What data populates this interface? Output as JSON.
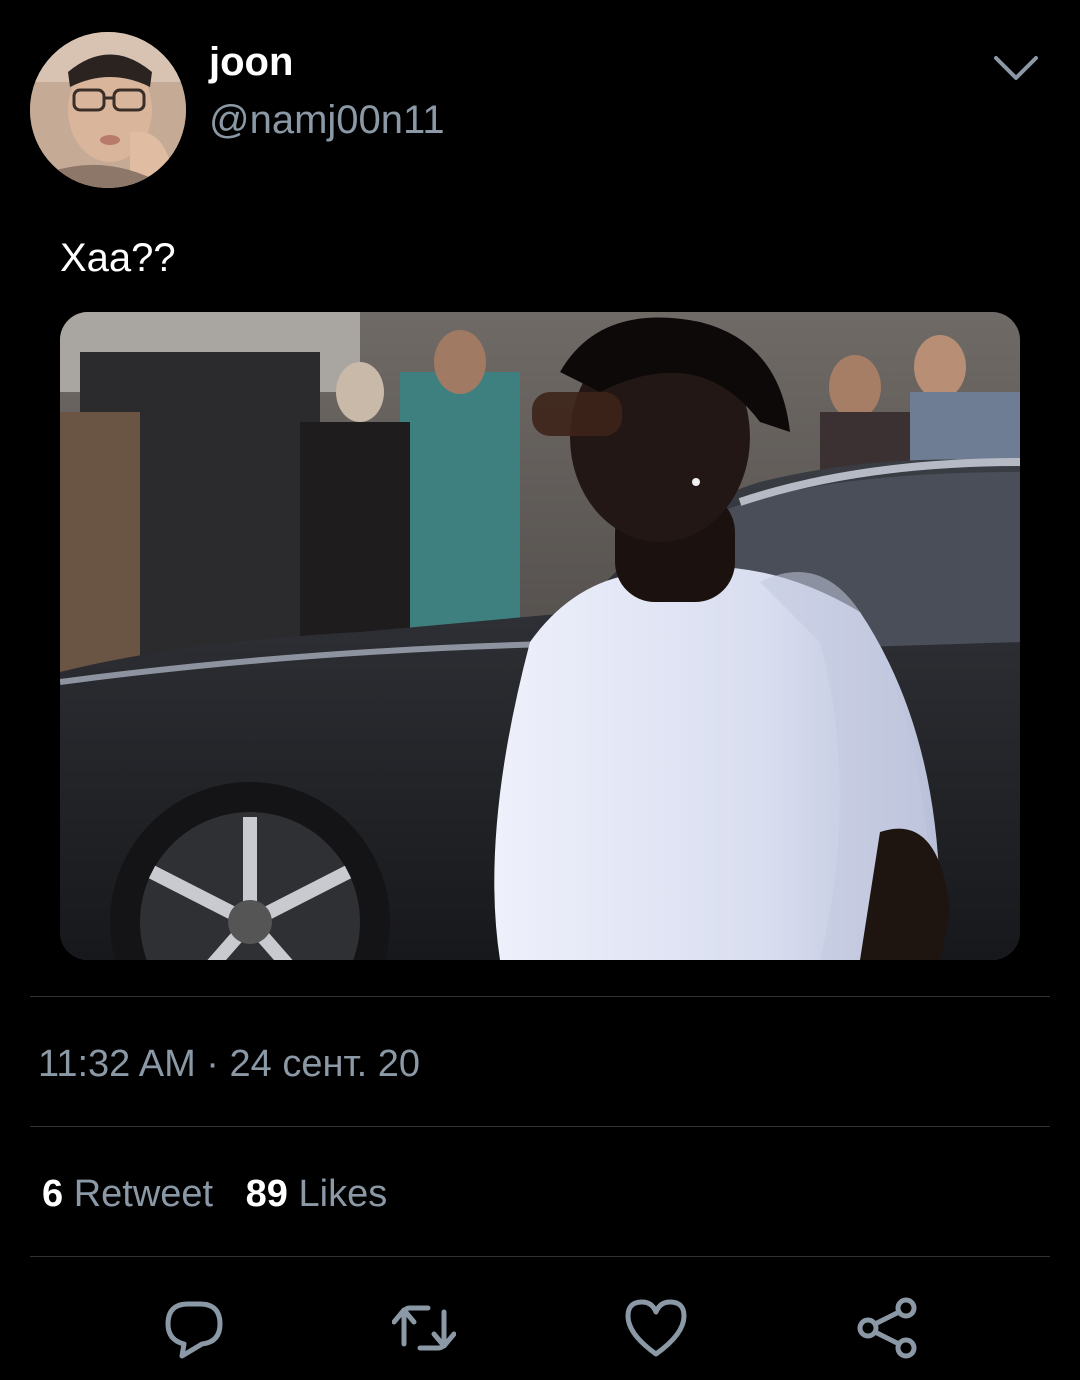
{
  "tweet": {
    "author": {
      "display_name": "joon",
      "handle": "@namj00n11"
    },
    "text": "Хаа??",
    "timestamp": "11:32 AM · 24 сент. 20",
    "stats": {
      "retweets": {
        "count": "6",
        "label": "Retweet"
      },
      "likes": {
        "count": "89",
        "label": "Likes"
      }
    },
    "actions": [
      {
        "name": "reply",
        "icon": "reply-icon"
      },
      {
        "name": "retweet",
        "icon": "retweet-icon"
      },
      {
        "name": "like",
        "icon": "heart-icon"
      },
      {
        "name": "share",
        "icon": "share-icon"
      }
    ]
  },
  "colors": {
    "background": "#000000",
    "primary_text": "#ffffff",
    "secondary_text": "#8b98a5",
    "divider": "#2f3336"
  }
}
